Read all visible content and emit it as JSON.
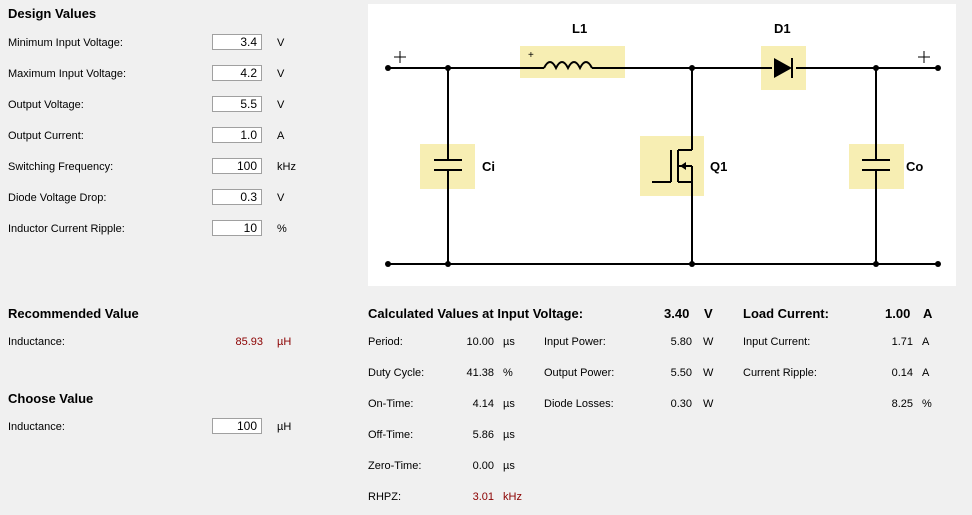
{
  "design": {
    "title": "Design Values",
    "rows": [
      {
        "label": "Minimum Input Voltage:",
        "value": "3.4",
        "unit": "V"
      },
      {
        "label": "Maximum Input Voltage:",
        "value": "4.2",
        "unit": "V"
      },
      {
        "label": "Output Voltage:",
        "value": "5.5",
        "unit": "V"
      },
      {
        "label": "Output Current:",
        "value": "1.0",
        "unit": "A"
      },
      {
        "label": "Switching Frequency:",
        "value": "100",
        "unit": "kHz"
      },
      {
        "label": "Diode Voltage Drop:",
        "value": "0.3",
        "unit": "V"
      },
      {
        "label": "Inductor Current Ripple:",
        "value": "10",
        "unit": "%"
      }
    ]
  },
  "schematic": {
    "L1": "L1",
    "D1": "D1",
    "Ci": "Ci",
    "Q1": "Q1",
    "Co": "Co",
    "plus": "+",
    "highlight_color": "#f7eeb3"
  },
  "recommended": {
    "title": "Recommended Value",
    "label": "Inductance:",
    "value": "85.93",
    "unit": "µH"
  },
  "choose": {
    "title": "Choose Value",
    "label": "Inductance:",
    "value": "100",
    "unit": "µH"
  },
  "calc": {
    "title": "Calculated Values at Input Voltage:",
    "input_voltage": "3.40",
    "input_voltage_unit": "V",
    "rows": [
      {
        "label": "Period:",
        "value": "10.00",
        "unit": "µs"
      },
      {
        "label": "Duty Cycle:",
        "value": "41.38",
        "unit": "%"
      },
      {
        "label": "On-Time:",
        "value": "4.14",
        "unit": "µs"
      },
      {
        "label": "Off-Time:",
        "value": "5.86",
        "unit": "µs"
      },
      {
        "label": "Zero-Time:",
        "value": "0.00",
        "unit": "µs"
      },
      {
        "label": "RHPZ:",
        "value": "3.01",
        "unit": "kHz"
      }
    ],
    "power": [
      {
        "label": "Input Power:",
        "value": "5.80",
        "unit": "W"
      },
      {
        "label": "Output Power:",
        "value": "5.50",
        "unit": "W"
      },
      {
        "label": "Diode Losses:",
        "value": "0.30",
        "unit": "W"
      }
    ]
  },
  "load": {
    "title": "Load Current:",
    "value": "1.00",
    "unit": "A",
    "rows": [
      {
        "label": "Input Current:",
        "value": "1.71",
        "unit": "A"
      },
      {
        "label": "Current Ripple:",
        "value": "0.14",
        "unit": "A"
      },
      {
        "label": "",
        "value": "8.25",
        "unit": "%"
      }
    ]
  },
  "colors": {
    "accent_red": "#8b0000"
  }
}
